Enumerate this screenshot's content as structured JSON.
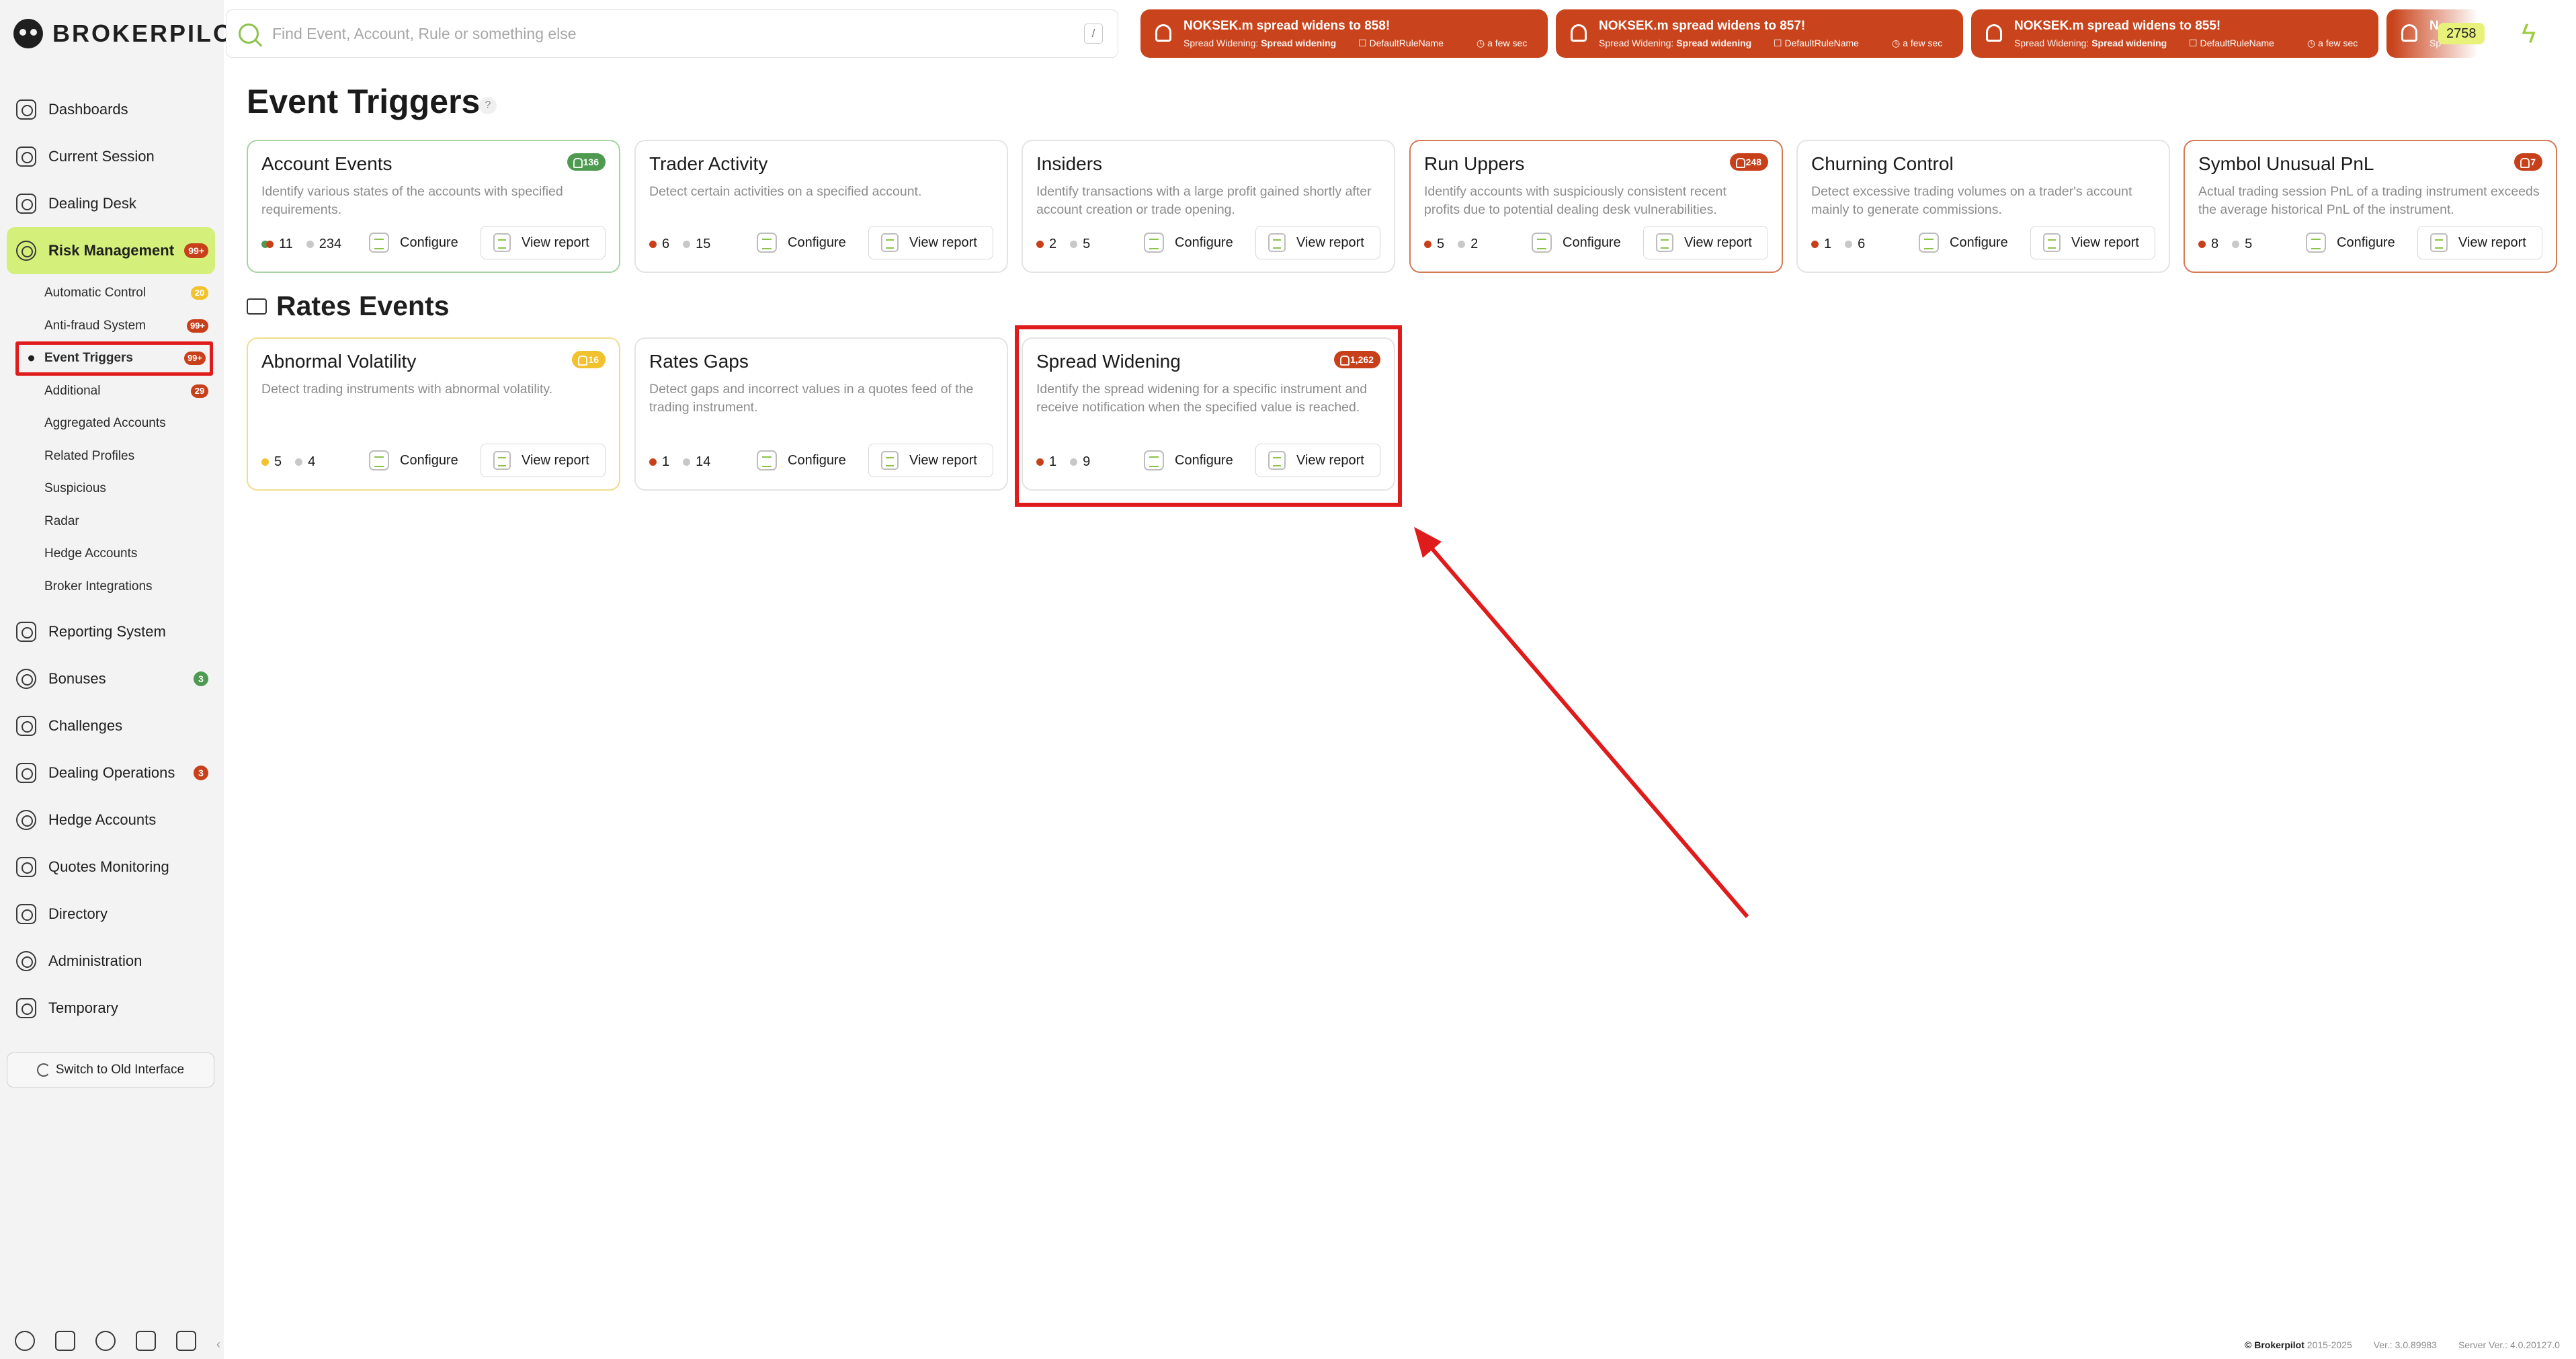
{
  "brand": {
    "name": "BROKERPILOT",
    "logo_icon": "owl-logo-icon"
  },
  "search": {
    "placeholder": "Find Event, Account, Rule or something else",
    "shortcut": "/"
  },
  "notifications": [
    {
      "title": "NOKSEK.m spread widens to 858!",
      "type": "Spread Widening:",
      "rule_type": "Spread widening",
      "rule_name": "DefaultRuleName",
      "time": "a few sec"
    },
    {
      "title": "NOKSEK.m spread widens to 857!",
      "type": "Spread Widening:",
      "rule_type": "Spread widening",
      "rule_name": "DefaultRuleName",
      "time": "a few sec"
    },
    {
      "title": "NOKSEK.m spread widens to 855!",
      "type": "Spread Widening:",
      "rule_type": "Spread widening",
      "rule_name": "DefaultRuleName",
      "time": "a few sec"
    },
    {
      "title": "N",
      "type": "Sp",
      "rule_type": "",
      "rule_name": "",
      "time": ""
    }
  ],
  "notification_count": "2758",
  "sidebar": {
    "items": [
      {
        "label": "Dashboards",
        "icon": "dashboard-icon"
      },
      {
        "label": "Current Session",
        "icon": "session-icon"
      },
      {
        "label": "Dealing Desk",
        "icon": "desk-icon"
      },
      {
        "label": "Risk Management",
        "icon": "risk-icon",
        "badge": "99+"
      },
      {
        "label": "Reporting System",
        "icon": "report-icon"
      },
      {
        "label": "Bonuses",
        "icon": "bonus-icon",
        "badge": "3"
      },
      {
        "label": "Challenges",
        "icon": "flag-icon"
      },
      {
        "label": "Dealing Operations",
        "icon": "operations-icon",
        "badge": "3"
      },
      {
        "label": "Hedge Accounts",
        "icon": "hedge-icon"
      },
      {
        "label": "Quotes Monitoring",
        "icon": "quotes-icon"
      },
      {
        "label": "Directory",
        "icon": "directory-icon"
      },
      {
        "label": "Administration",
        "icon": "admin-icon"
      },
      {
        "label": "Temporary",
        "icon": "temporary-icon"
      }
    ],
    "subitems": [
      {
        "label": "Automatic Control",
        "badge": "20"
      },
      {
        "label": "Anti-fraud System",
        "badge": "99+"
      },
      {
        "label": "Event Triggers",
        "badge": "99+"
      },
      {
        "label": "Additional",
        "badge": "29"
      },
      {
        "label": "Aggregated Accounts"
      },
      {
        "label": "Related Profiles"
      },
      {
        "label": "Suspicious"
      },
      {
        "label": "Radar"
      },
      {
        "label": "Hedge Accounts"
      },
      {
        "label": "Broker Integrations"
      }
    ],
    "switch_label": "Switch to Old Interface"
  },
  "page": {
    "title": "Event Triggers",
    "help": "?",
    "section2_title": "Rates Events"
  },
  "cards": [
    {
      "title": "Account Events",
      "badge": "136",
      "desc": "Identify various states of the accounts with specified requirements.",
      "stat1": "11",
      "stat2": "234",
      "configure": "Configure",
      "report": "View report"
    },
    {
      "title": "Trader Activity",
      "badge": "",
      "desc": "Detect certain activities on a specified account.",
      "stat1": "6",
      "stat2": "15",
      "configure": "Configure",
      "report": "View report"
    },
    {
      "title": "Insiders",
      "badge": "",
      "desc": "Identify transactions with a large profit gained shortly after account creation or trade opening.",
      "stat1": "2",
      "stat2": "5",
      "configure": "Configure",
      "report": "View report"
    },
    {
      "title": "Run Uppers",
      "badge": "248",
      "desc": "Identify accounts with suspiciously consistent recent profits due to potential dealing desk vulnerabilities.",
      "stat1": "5",
      "stat2": "2",
      "configure": "Configure",
      "report": "View report"
    },
    {
      "title": "Churning Control",
      "badge": "",
      "desc": "Detect excessive trading volumes on a trader's account mainly to generate commissions.",
      "stat1": "1",
      "stat2": "6",
      "configure": "Configure",
      "report": "View report"
    },
    {
      "title": "Symbol Unusual PnL",
      "badge": "7",
      "desc": "Actual trading session PnL of a trading instrument exceeds the average historical PnL of the instrument.",
      "stat1": "8",
      "stat2": "5",
      "configure": "Configure",
      "report": "View report"
    },
    {
      "title": "Abnormal Volatility",
      "badge": "16",
      "desc": "Detect trading instruments with abnormal volatility.",
      "stat1": "5",
      "stat2": "4",
      "configure": "Configure",
      "report": "View report"
    },
    {
      "title": "Rates Gaps",
      "badge": "",
      "desc": "Detect gaps and incorrect values in a quotes feed of the trading instrument.",
      "stat1": "1",
      "stat2": "14",
      "configure": "Configure",
      "report": "View report"
    },
    {
      "title": "Spread Widening",
      "badge": "1,262",
      "desc": "Identify the spread widening for a specific instrument and receive notification when the specified value is reached.",
      "stat1": "1",
      "stat2": "9",
      "configure": "Configure",
      "report": "View report"
    }
  ],
  "footer": {
    "brand": "© Brokerpilot",
    "years": "2015-2025",
    "ver": "Ver.: 3.0.89983",
    "server_ver": "Server Ver.: 4.0.20127.0"
  },
  "colors": {
    "accent": "#d4f07a",
    "alert": "#c9441c",
    "highlight": "#e01b1b"
  }
}
